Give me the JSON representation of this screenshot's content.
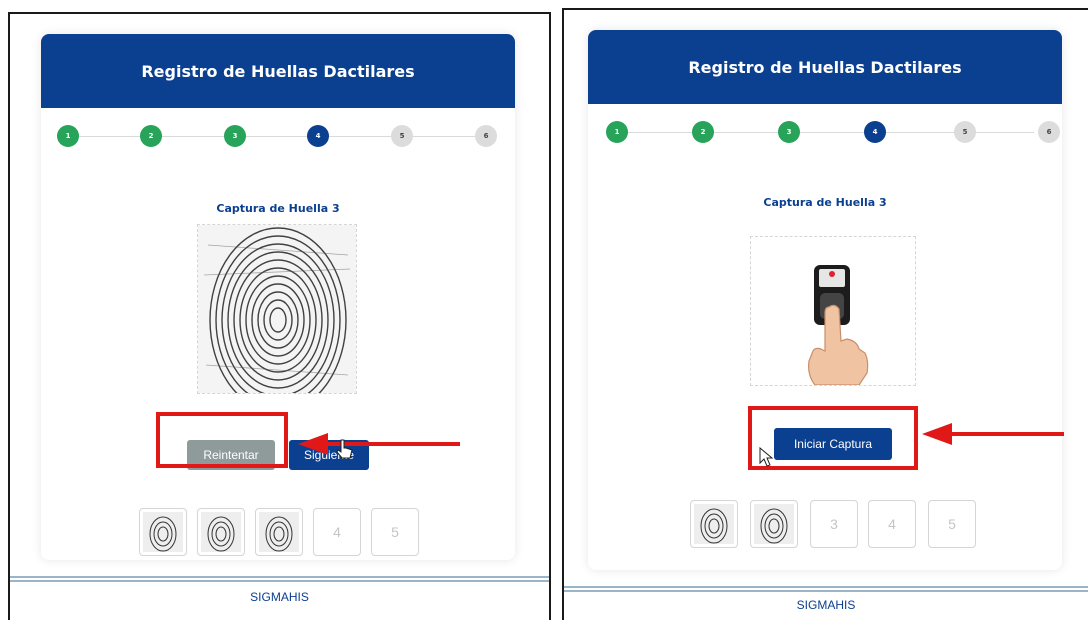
{
  "left": {
    "header_title": "Registro de Huellas Dactilares",
    "steps": [
      "1",
      "2",
      "3",
      "4",
      "5",
      "6"
    ],
    "capture_title": "Captura de Huella 3",
    "retry_button": "Reintentar",
    "next_button": "Siguiente",
    "thumbnails": [
      "",
      "",
      "",
      "4",
      "5"
    ],
    "footer": "SIGMAHIS"
  },
  "right": {
    "header_title": "Registro de Huellas Dactilares",
    "steps": [
      "1",
      "2",
      "3",
      "4",
      "5",
      "6"
    ],
    "capture_title": "Captura de Huella 3",
    "start_button": "Iniciar Captura",
    "thumbnails": [
      "",
      "",
      "3",
      "4",
      "5"
    ],
    "footer": "SIGMAHIS"
  },
  "colors": {
    "header_blue": "#0b3f8f",
    "step_done": "#27a35a",
    "step_pending": "#dcdcdc",
    "highlight_red": "#e01818",
    "retry_grey": "#8f9a9a"
  },
  "icons": [
    "fingerprint-icon",
    "fingerprint-scanner-icon",
    "hand-icon",
    "arrow-left-icon",
    "mouse-cursor-icon"
  ]
}
